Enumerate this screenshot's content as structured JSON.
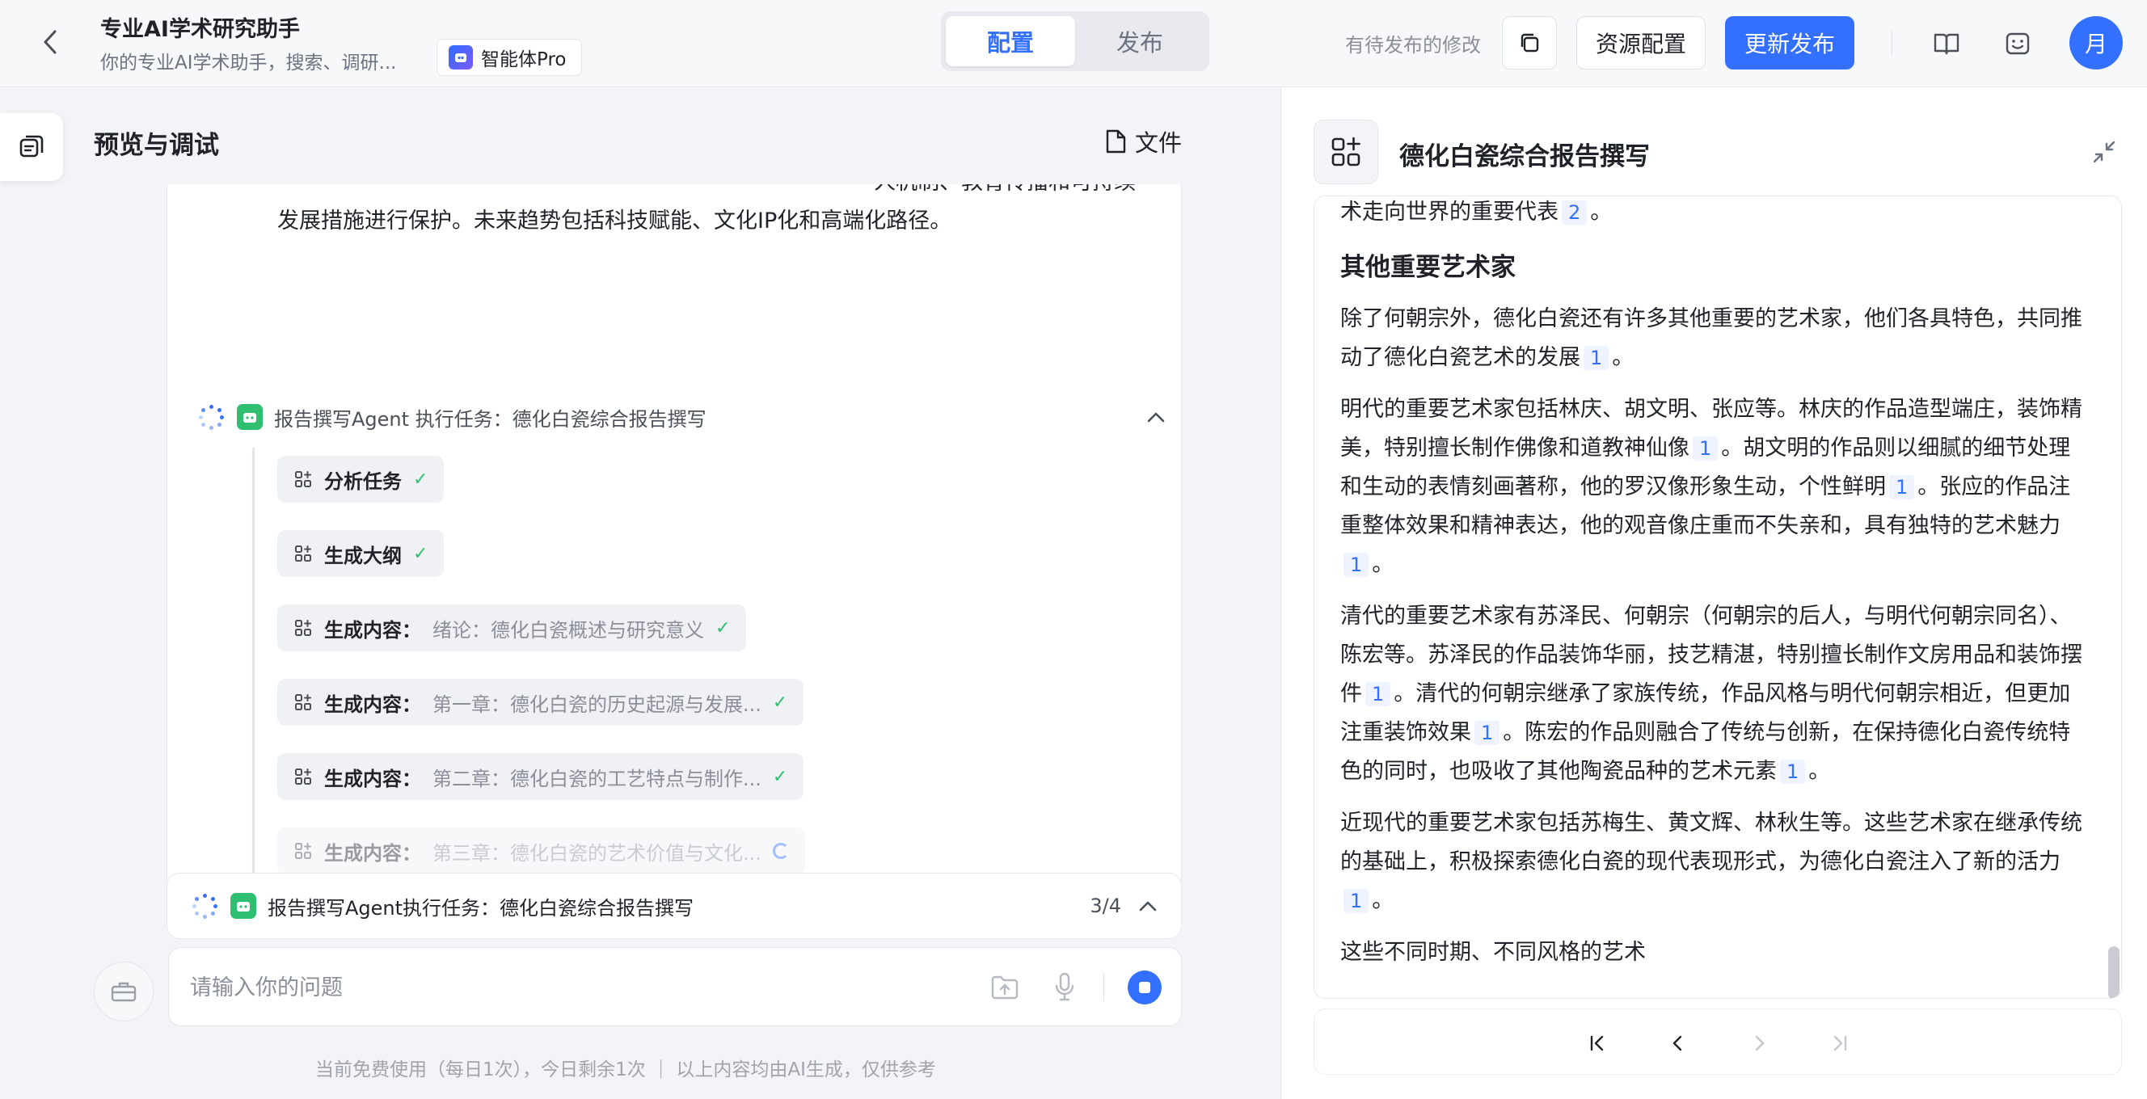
{
  "header": {
    "app_title": "专业AI学术研究助手",
    "app_subtitle": "你的专业AI学术助手，搜索、调研...",
    "badge_label": "智能体Pro",
    "mode_tabs": [
      {
        "label": "配置",
        "active": true
      },
      {
        "label": "发布",
        "active": false
      }
    ],
    "pending_text": "有待发布的修改",
    "resource_button": "资源配置",
    "publish_button": "更新发布",
    "avatar_text": "月"
  },
  "preview": {
    "title": "预览与调试",
    "file_button": "文件",
    "summary_text": "······················································································人机制、教育传播和可持续发展措施进行保护。未来趋势包括科技赋能、文化IP化和高端化路径。",
    "task_title": "报告撰写Agent 执行任务：德化白瓷综合报告撰写",
    "steps": [
      {
        "label": "分析任务",
        "sub": "",
        "status": "done"
      },
      {
        "label": "生成大纲",
        "sub": "",
        "status": "done"
      },
      {
        "label": "生成内容：",
        "sub": "绪论：德化白瓷概述与研究意义",
        "status": "done"
      },
      {
        "label": "生成内容：",
        "sub": "第一章：德化白瓷的历史起源与发展...",
        "status": "done"
      },
      {
        "label": "生成内容：",
        "sub": "第二章：德化白瓷的工艺特点与制作...",
        "status": "done"
      },
      {
        "label": "生成内容：",
        "sub": "第三章：德化白瓷的艺术价值与文化...",
        "status": "loading"
      }
    ],
    "agent_bar": {
      "title": "报告撰写Agent执行任务：德化白瓷综合报告撰写",
      "progress": "3/4"
    },
    "input_placeholder": "请输入你的问题",
    "footer_note": "当前免费使用（每日1次），今日剩余1次 ｜ 以上内容均由AI生成，仅供参考"
  },
  "document": {
    "title": "德化白瓷综合报告撰写",
    "lead_text": "术走向世界的重要代表",
    "lead_ref": "2",
    "heading": "其他重要艺术家",
    "paragraphs": [
      {
        "segments": [
          {
            "t": "除了何朝宗外，德化白瓷还有许多其他重要的艺术家，他们各具特色，共同推动了德化白瓷艺术的发展"
          },
          {
            "r": "1"
          },
          {
            "t": "。"
          }
        ]
      },
      {
        "segments": [
          {
            "t": "明代的重要艺术家包括林庆、胡文明、张应等。林庆的作品造型端庄，装饰精美，特别擅长制作佛像和道教神仙像"
          },
          {
            "r": "1"
          },
          {
            "t": "。胡文明的作品则以细腻的细节处理和生动的表情刻画著称，他的罗汉像形象生动，个性鲜明"
          },
          {
            "r": "1"
          },
          {
            "t": "。张应的作品注重整体效果和精神表达，他的观音像庄重而不失亲和，具有独特的艺术魅力"
          },
          {
            "r": "1"
          },
          {
            "t": "。"
          }
        ]
      },
      {
        "segments": [
          {
            "t": "清代的重要艺术家有苏泽民、何朝宗（何朝宗的后人，与明代何朝宗同名）、陈宏等。苏泽民的作品装饰华丽，技艺精湛，特别擅长制作文房用品和装饰摆件"
          },
          {
            "r": "1"
          },
          {
            "t": "。清代的何朝宗继承了家族传统，作品风格与明代何朝宗相近，但更加注重装饰效果"
          },
          {
            "r": "1"
          },
          {
            "t": "。陈宏的作品则融合了传统与创新，在保持德化白瓷传统特色的同时，也吸收了其他陶瓷品种的艺术元素"
          },
          {
            "r": "1"
          },
          {
            "t": "。"
          }
        ]
      },
      {
        "segments": [
          {
            "t": "近现代的重要艺术家包括苏梅生、黄文辉、林秋生等。这些艺术家在继承传统的基础上，积极探索德化白瓷的现代表现形式，为德化白瓷注入了新的活力"
          },
          {
            "r": "1"
          },
          {
            "t": "。"
          }
        ]
      },
      {
        "segments": [
          {
            "t": "这些不同时期、不同风格的艺术"
          }
        ]
      }
    ]
  },
  "colors": {
    "accent": "#3370ff",
    "success": "#2fbf71",
    "agent_icon": "#2fbf71"
  }
}
